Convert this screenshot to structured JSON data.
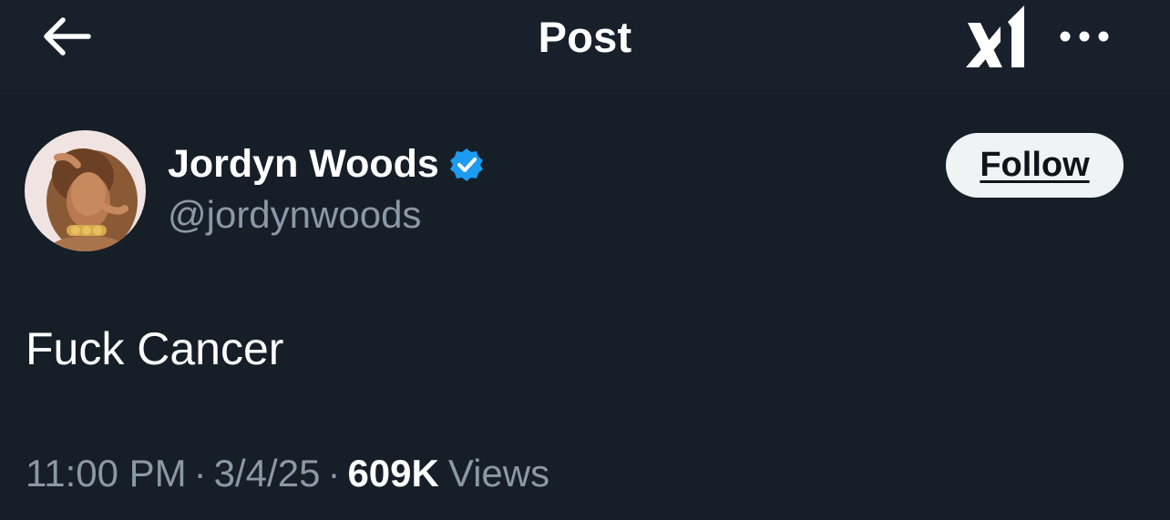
{
  "header": {
    "title": "Post",
    "back_icon": "arrow-left-icon",
    "grok_icon": "grok-icon",
    "more_icon": "more-horizontal-icon"
  },
  "author": {
    "display_name": "Jordyn Woods",
    "handle": "@jordynwoods",
    "verified": true,
    "verified_color": "#1d9bf0",
    "avatar_icon": "profile-photo"
  },
  "follow_button": {
    "label": "Follow"
  },
  "post": {
    "text": "Fuck Cancer"
  },
  "meta": {
    "time": "11:00 PM",
    "date": "3/4/25",
    "separator": "·",
    "views_count": "609K",
    "views_label": "Views"
  },
  "colors": {
    "background": "#161e28",
    "text_primary": "#ffffff",
    "text_secondary": "#8b98a5",
    "button_bg": "#eff3f4"
  }
}
